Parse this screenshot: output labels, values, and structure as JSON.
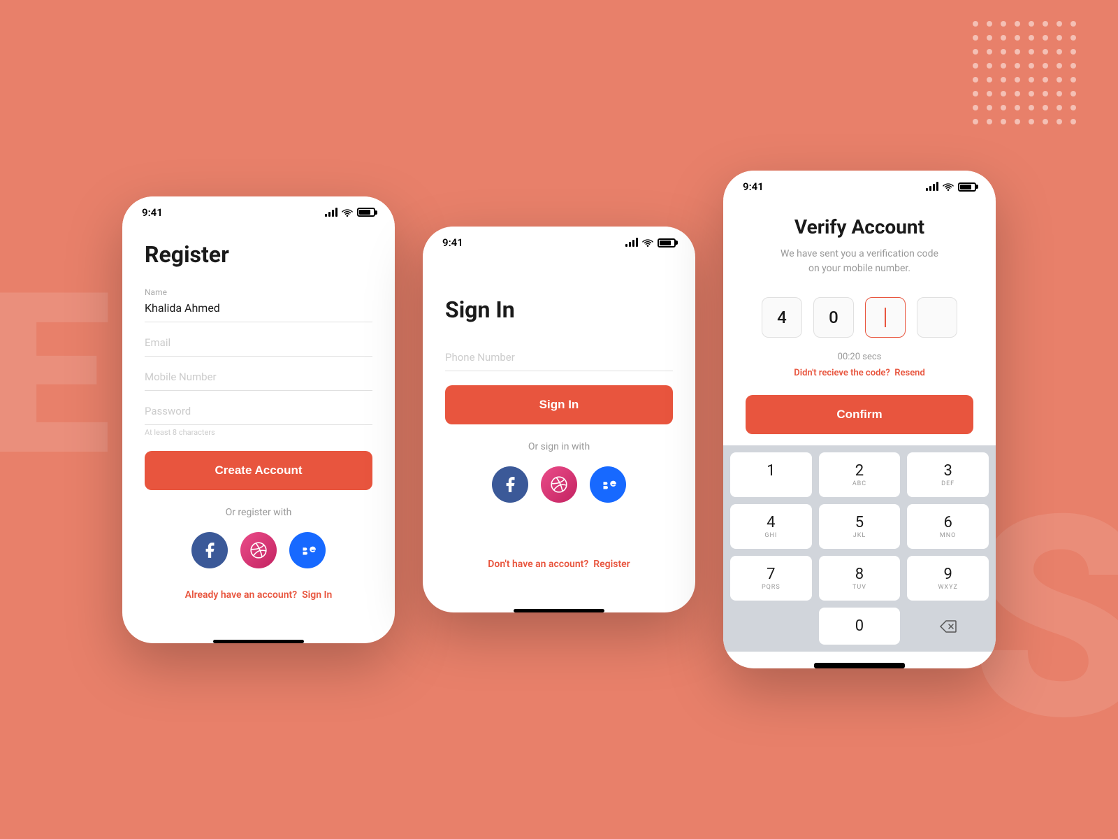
{
  "background": {
    "color": "#e8806a"
  },
  "accent_color": "#e8553e",
  "screens": {
    "register": {
      "status_time": "9:41",
      "title": "Register",
      "fields": {
        "name": {
          "label": "Name",
          "value": "Khalida Ahmed"
        },
        "email": {
          "placeholder": "Email"
        },
        "mobile": {
          "placeholder": "Mobile Number"
        },
        "password": {
          "placeholder": "Password",
          "hint": "At least 8 characters"
        }
      },
      "create_account_btn": "Create Account",
      "or_text": "Or register with",
      "bottom_text": "Already have an account?",
      "bottom_link": "Sign In"
    },
    "signin": {
      "status_time": "9:41",
      "title": "Sign In",
      "phone_placeholder": "Phone Number",
      "signin_btn": "Sign In",
      "or_text": "Or sign in with",
      "bottom_text": "Don't have an account?",
      "bottom_link": "Register"
    },
    "verify": {
      "status_time": "9:41",
      "title": "Verify Account",
      "subtitle": "We have sent you a verification code\non your mobile number.",
      "otp_digits": [
        "4",
        "0",
        "|",
        ""
      ],
      "timer": "00:20 secs",
      "resend_text": "Didn't recieve the code?",
      "resend_link": "Resend",
      "confirm_btn": "Confirm",
      "numpad": [
        {
          "num": "1",
          "letters": ""
        },
        {
          "num": "2",
          "letters": "ABC"
        },
        {
          "num": "3",
          "letters": "DEF"
        },
        {
          "num": "4",
          "letters": "GHI"
        },
        {
          "num": "5",
          "letters": "JKL"
        },
        {
          "num": "6",
          "letters": "MNO"
        },
        {
          "num": "7",
          "letters": "PQRS"
        },
        {
          "num": "8",
          "letters": "TUV"
        },
        {
          "num": "9",
          "letters": "WXYZ"
        },
        {
          "num": "0",
          "letters": ""
        }
      ]
    }
  }
}
